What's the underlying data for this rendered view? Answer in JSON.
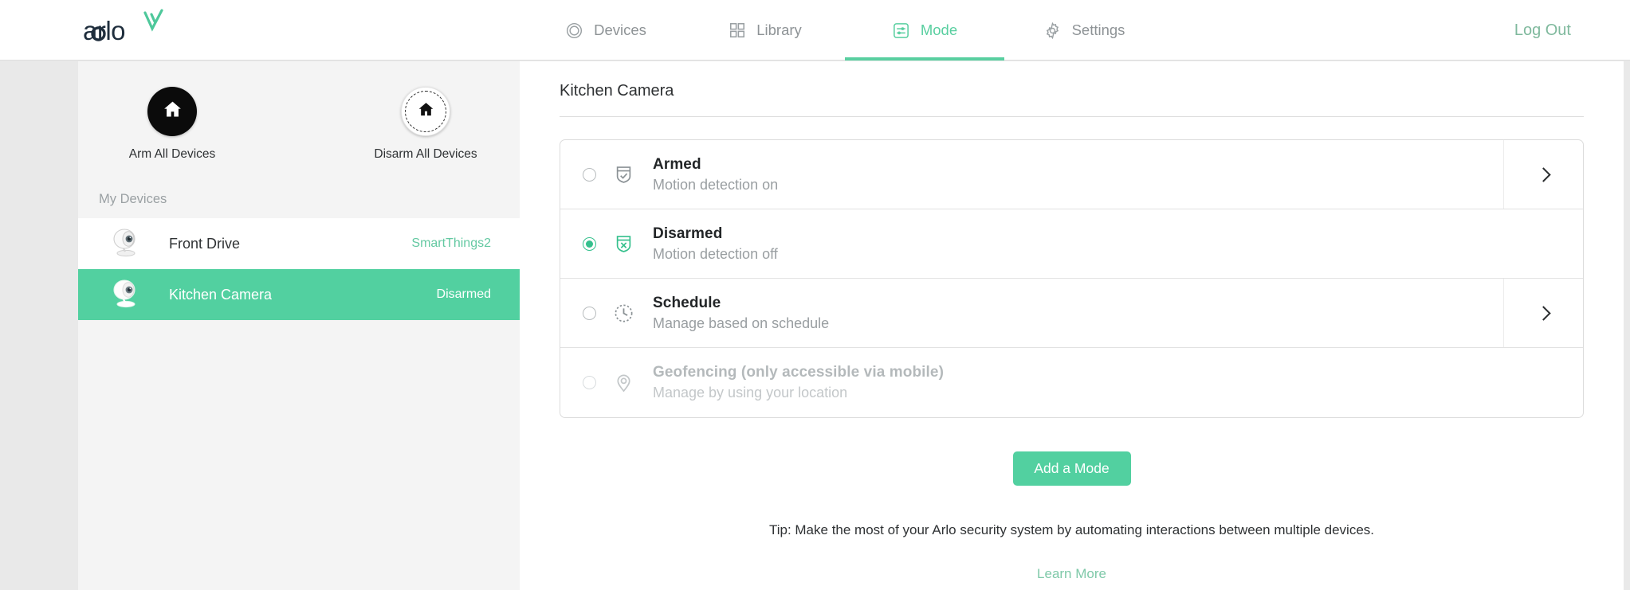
{
  "brand": {
    "name": "arlo",
    "accent": "#52d0a0",
    "logo_dark": "#1f2e3d"
  },
  "header": {
    "nav": [
      {
        "label": "Devices",
        "icon": "camera-lens-icon",
        "active": false
      },
      {
        "label": "Library",
        "icon": "grid-icon",
        "active": false
      },
      {
        "label": "Mode",
        "icon": "sliders-icon",
        "active": true
      },
      {
        "label": "Settings",
        "icon": "gear-icon",
        "active": false
      }
    ],
    "logout_label": "Log Out"
  },
  "sidebar": {
    "quick_actions": [
      {
        "label": "Arm All Devices",
        "icon": "home-icon",
        "style": "filled"
      },
      {
        "label": "Disarm All Devices",
        "icon": "home-icon",
        "style": "dashed-outline"
      }
    ],
    "section_label": "My Devices",
    "devices": [
      {
        "name": "Front Drive",
        "status": "SmartThings2",
        "selected": false,
        "icon": "camera-icon"
      },
      {
        "name": "Kitchen Camera",
        "status": "Disarmed",
        "selected": true,
        "icon": "camera-icon"
      }
    ]
  },
  "main": {
    "title": "Kitchen Camera",
    "modes": [
      {
        "name": "Armed",
        "description": "Motion detection on",
        "icon": "shield-check-icon",
        "selected": false,
        "disabled": false,
        "has_chevron": true
      },
      {
        "name": "Disarmed",
        "description": "Motion detection off",
        "icon": "shield-x-icon",
        "selected": true,
        "disabled": false,
        "has_chevron": false
      },
      {
        "name": "Schedule",
        "description": "Manage based on schedule",
        "icon": "clock-icon",
        "selected": false,
        "disabled": false,
        "has_chevron": true
      },
      {
        "name": "Geofencing (only accessible via mobile)",
        "description": "Manage by using your location",
        "icon": "map-pin-icon",
        "selected": false,
        "disabled": true,
        "has_chevron": false
      }
    ],
    "add_mode_label": "Add a Mode",
    "tip_text": "Tip: Make the most of your Arlo security system by automating interactions between multiple devices.",
    "learn_more_label": "Learn More"
  }
}
